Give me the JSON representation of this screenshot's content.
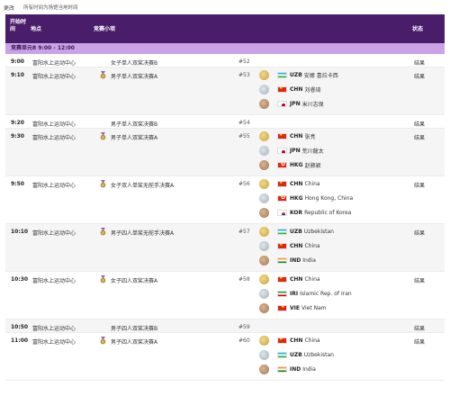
{
  "topbar": {
    "back_label": "更改",
    "tz_note": "所有时间为场馆当地时间"
  },
  "header": {
    "time": "开始时间",
    "venue": "地点",
    "event": "竞赛小项",
    "status": "状态"
  },
  "unit": "竞赛单元8 9:00 - 12:00",
  "colors": {
    "header_bg": "#4a1d6b",
    "unit_bg": "#c9a3e6"
  },
  "rows": [
    {
      "time": "9:00",
      "venue": "富阳水上运动中心",
      "event": "女子单人双桨决赛B",
      "num": "#52",
      "status": "结果",
      "medal": false,
      "results": []
    },
    {
      "time": "9:10",
      "venue": "富阳水上运动中心",
      "event": "男子单人双桨决赛A",
      "num": "#53",
      "status": "结果",
      "medal": true,
      "results": [
        {
          "flag": "uzb",
          "code": "UZB",
          "name": "安娜 喜拉卡西"
        },
        {
          "flag": "chn",
          "code": "CHN",
          "name": "刘睿琦"
        },
        {
          "flag": "jpn",
          "code": "JPN",
          "name": "米川志保"
        }
      ]
    },
    {
      "time": "9:20",
      "venue": "富阳水上运动中心",
      "event": "男子单人双桨决赛B",
      "num": "#54",
      "status": "结果",
      "medal": false,
      "results": []
    },
    {
      "time": "9:30",
      "venue": "富阳水上运动中心",
      "event": "男子单人双桨决赛A",
      "num": "#55",
      "status": "结果",
      "medal": true,
      "results": [
        {
          "flag": "chn",
          "code": "CHN",
          "name": "张亮"
        },
        {
          "flag": "jpn",
          "code": "JPN",
          "name": "荒川龍太"
        },
        {
          "flag": "hkg",
          "code": "HKG",
          "name": "赵颢颖"
        }
      ]
    },
    {
      "time": "9:50",
      "venue": "富阳水上运动中心",
      "event": "女子双人单桨无舵手决赛A",
      "num": "#56",
      "status": "结果",
      "medal": true,
      "results": [
        {
          "flag": "chn",
          "code": "CHN",
          "name": "China"
        },
        {
          "flag": "hkg",
          "code": "HKG",
          "name": "Hong Kong, China"
        },
        {
          "flag": "kor",
          "code": "KOR",
          "name": "Republic of Korea"
        }
      ]
    },
    {
      "time": "10:10",
      "venue": "富阳水上运动中心",
      "event": "男子四人单桨无舵手决赛A",
      "num": "#57",
      "status": "结果",
      "medal": true,
      "results": [
        {
          "flag": "uzb",
          "code": "UZB",
          "name": "Uzbekistan"
        },
        {
          "flag": "chn",
          "code": "CHN",
          "name": "China"
        },
        {
          "flag": "ind",
          "code": "IND",
          "name": "India"
        }
      ]
    },
    {
      "time": "10:30",
      "venue": "富阳水上运动中心",
      "event": "女子四人双桨决赛A",
      "num": "#58",
      "status": "结果",
      "medal": true,
      "results": [
        {
          "flag": "chn",
          "code": "CHN",
          "name": "China"
        },
        {
          "flag": "iri",
          "code": "IRI",
          "name": "Islamic Rep. of Iran"
        },
        {
          "flag": "vie",
          "code": "VIE",
          "name": "Viet Nam"
        }
      ]
    },
    {
      "time": "10:50",
      "venue": "富阳水上运动中心",
      "event": "男子四人双桨决赛B",
      "num": "#59",
      "status": "结果",
      "medal": false,
      "results": []
    },
    {
      "time": "11:00",
      "venue": "富阳水上运动中心",
      "event": "男子四人双桨决赛A",
      "num": "#60",
      "status": "结果",
      "medal": true,
      "results": [
        {
          "flag": "chn",
          "code": "CHN",
          "name": "China"
        },
        {
          "flag": "uzb",
          "code": "UZB",
          "name": "Uzbekistan"
        },
        {
          "flag": "ind",
          "code": "IND",
          "name": "India"
        }
      ]
    }
  ]
}
